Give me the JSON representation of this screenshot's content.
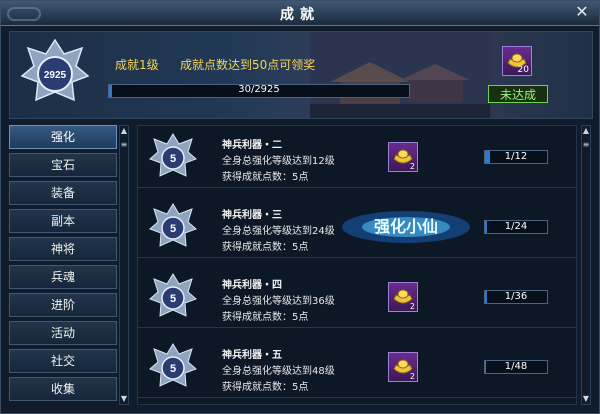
{
  "window": {
    "title": "成就"
  },
  "header": {
    "total_points": "2925",
    "level": "成就1级",
    "requirement": "成就点数达到50点可领奖",
    "progress_text": "30/2925",
    "progress_fraction": 0.01,
    "reward_count": "20",
    "status_button": "未达成"
  },
  "sidebar": {
    "items": [
      {
        "label": "强化"
      },
      {
        "label": "宝石"
      },
      {
        "label": "装备"
      },
      {
        "label": "副本"
      },
      {
        "label": "神将"
      },
      {
        "label": "兵魂"
      },
      {
        "label": "进阶"
      },
      {
        "label": "活动"
      },
      {
        "label": "社交"
      },
      {
        "label": "收集"
      }
    ]
  },
  "rows": [
    {
      "medal": "5",
      "name": "神兵利器・二",
      "desc": "全身总强化等级达到12级",
      "points": "获得成就点数：5点",
      "reward_count": "2",
      "progress": "1/12",
      "progress_fraction": 0.083
    },
    {
      "medal": "5",
      "name": "神兵利器・三",
      "desc": "全身总强化等级达到24级",
      "points": "获得成就点数：5点",
      "logo": "强化小仙",
      "progress": "1/24",
      "progress_fraction": 0.042
    },
    {
      "medal": "5",
      "name": "神兵利器・四",
      "desc": "全身总强化等级达到36级",
      "points": "获得成就点数：5点",
      "reward_count": "2",
      "progress": "1/36",
      "progress_fraction": 0.028
    },
    {
      "medal": "5",
      "name": "神兵利器・五",
      "desc": "全身总强化等级达到48级",
      "points": "获得成就点数：5点",
      "reward_count": "2",
      "progress": "1/48",
      "progress_fraction": 0.021
    }
  ]
}
